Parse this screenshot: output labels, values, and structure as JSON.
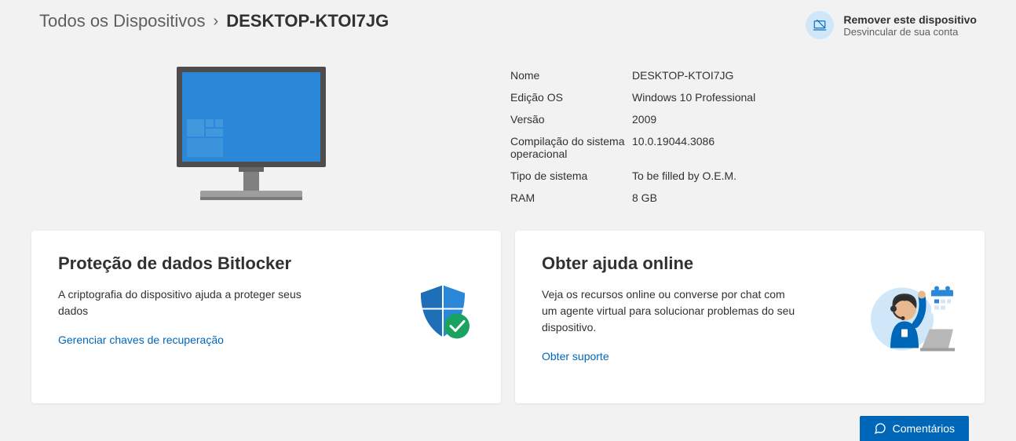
{
  "breadcrumb": {
    "parent": "Todos os Dispositivos",
    "separator": "›",
    "current": "DESKTOP-KTOI7JG"
  },
  "remove": {
    "title": "Remover este dispositivo",
    "subtitle": "Desvincular de sua conta"
  },
  "specs": [
    {
      "label": "Nome",
      "value": "DESKTOP-KTOI7JG"
    },
    {
      "label": "Edição OS",
      "value": "Windows 10 Professional"
    },
    {
      "label": "Versão",
      "value": "2009"
    },
    {
      "label": "Compilação do sistema operacional",
      "value": "10.0.19044.3086"
    },
    {
      "label": "Tipo de sistema",
      "value": "To be filled by O.E.M."
    },
    {
      "label": "RAM",
      "value": "8 GB"
    }
  ],
  "cards": {
    "bitlocker": {
      "title": "Proteção de dados Bitlocker",
      "desc": "A criptografia do dispositivo ajuda a proteger seus dados",
      "link": "Gerenciar chaves de recuperação"
    },
    "help": {
      "title": "Obter ajuda online",
      "desc": "Veja os recursos online ou converse por chat com um agente virtual para solucionar problemas do seu dispositivo.",
      "link": "Obter suporte"
    }
  },
  "feedback": {
    "label": "Comentários"
  }
}
